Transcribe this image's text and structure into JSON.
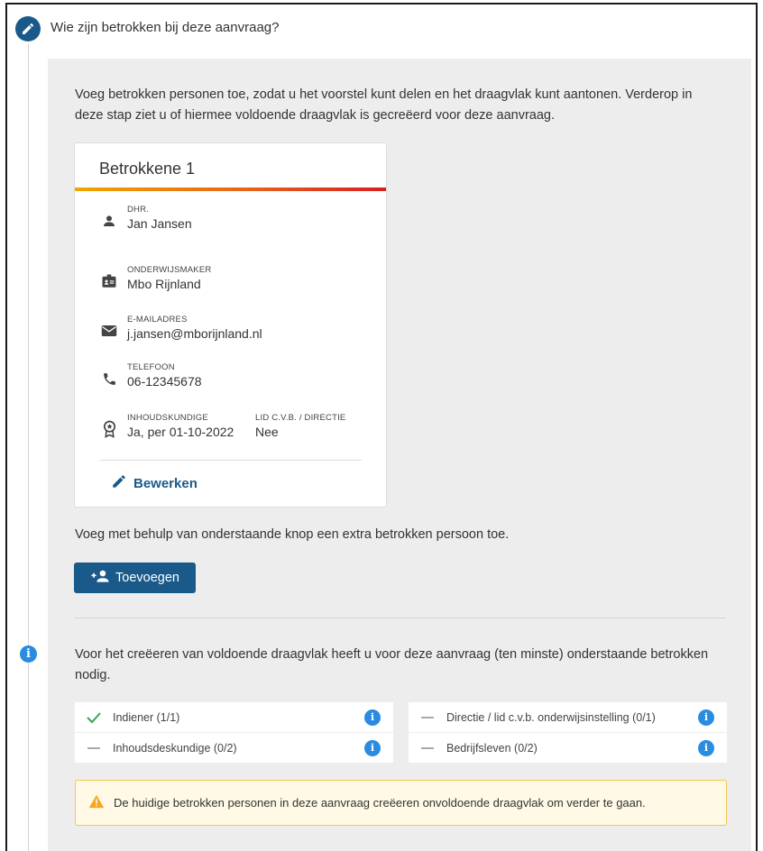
{
  "step": {
    "title": "Wie zijn betrokken bij deze aanvraag?"
  },
  "intro": {
    "text": "Voeg betrokken personen toe, zodat u het voorstel kunt delen en het draagvlak kunt aantonen. Verderop in deze stap ziet u of hiermee voldoende draagvlak is gecreëerd voor deze aanvraag."
  },
  "card": {
    "title": "Betrokkene 1",
    "salutation_label": "DHR.",
    "name": "Jan Jansen",
    "org_label": "ONDERWIJSMAKER",
    "org": "Mbo Rijnland",
    "email_label": "E-MAILADRES",
    "email": "j.jansen@mborijnland.nl",
    "phone_label": "TELEFOON",
    "phone": "06-12345678",
    "expert_label": "INHOUDSKUNDIGE",
    "expert": "Ja, per 01-10-2022",
    "board_label": "LID C.V.B. / DIRECTIE",
    "board": "Nee",
    "edit_label": "Bewerken"
  },
  "add": {
    "text": "Voeg met behulp van onderstaande knop een extra betrokken persoon toe.",
    "button_label": "Toevoegen"
  },
  "requirements": {
    "intro": "Voor het creëeren van voldoende draagvlak heeft u voor deze aanvraag (ten minste) onderstaande betrokken nodig.",
    "items": [
      {
        "label": "Indiener (1/1)",
        "status": "complete"
      },
      {
        "label": "Directie / lid c.v.b. onderwijsinstelling (0/1)",
        "status": "incomplete"
      },
      {
        "label": "Inhoudsdeskundige (0/2)",
        "status": "incomplete"
      },
      {
        "label": "Bedrijfsleven (0/2)",
        "status": "incomplete"
      }
    ],
    "info_glyph": "i"
  },
  "warning": {
    "text": "De huidige betrokken personen in deze aanvraag creëeren onvoldoende draagvlak om verder te gaan."
  },
  "colors": {
    "primary": "#1a5a8a",
    "info": "#2a8ce0",
    "check": "#3aa55a",
    "warning_bg": "#fff9e6",
    "warning_border": "#f2c94c",
    "warning_icon": "#f5a623"
  },
  "icons": {
    "step": "pencil-icon",
    "person": "person-icon",
    "org": "badge-icon",
    "email": "envelope-icon",
    "phone": "phone-icon",
    "expert": "award-icon",
    "edit": "pencil-icon",
    "add": "person-add-icon",
    "info": "info-icon",
    "check": "check-icon",
    "warning": "warning-triangle-icon"
  }
}
